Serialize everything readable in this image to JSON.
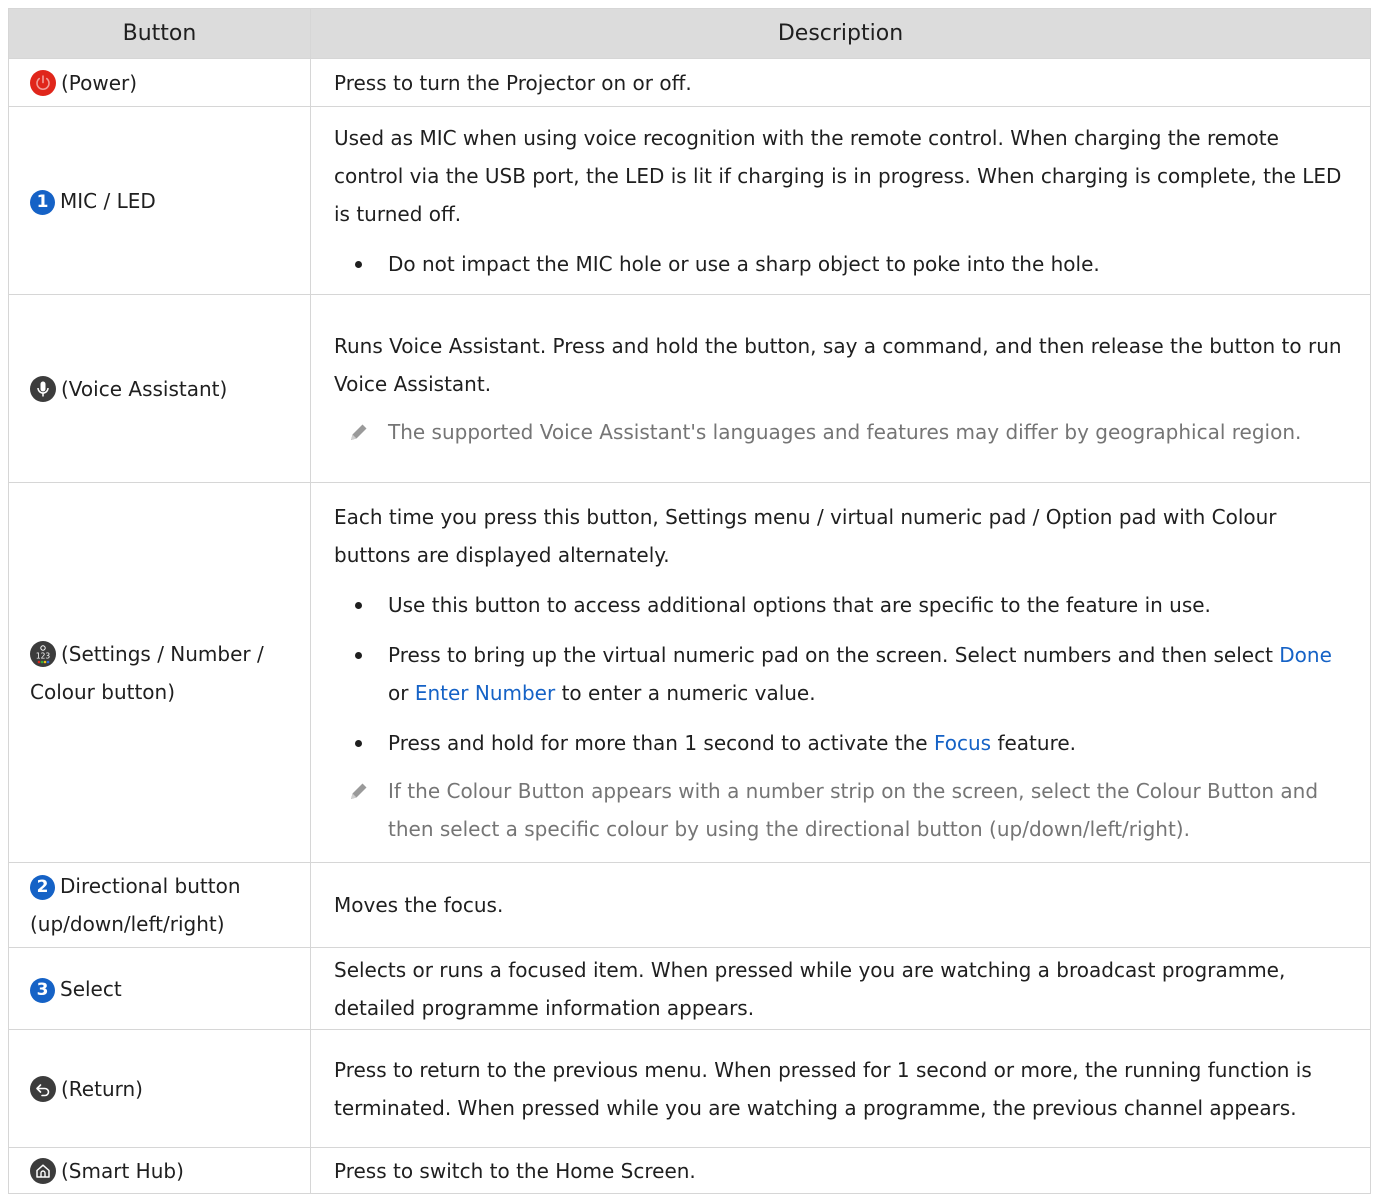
{
  "headers": {
    "button": "Button",
    "description": "Description"
  },
  "colors": {
    "header_bg": "#dcdcdc",
    "link": "#1562c6",
    "power": "#e0261b",
    "icon_dark": "#3c3c3c",
    "note_text": "#757575"
  },
  "rows": [
    {
      "icon": "power-icon",
      "label": "(Power)",
      "desc": "Press to turn the Projector on or off."
    },
    {
      "badge": "1",
      "label": "MIC / LED",
      "desc": "Used as MIC when using voice recognition with the remote control. When charging the remote control via the USB port, the LED is lit if charging is in progress. When charging is complete, the LED is turned off.",
      "bullet": "Do not impact the MIC hole or use a sharp object to poke into the hole."
    },
    {
      "icon": "microphone-icon",
      "label": "(Voice Assistant)",
      "desc": "Runs Voice Assistant. Press and hold the button, say a command, and then release the button to run Voice Assistant.",
      "note": "The supported Voice Assistant's languages and features may differ by geographical region."
    },
    {
      "icon": "settings-number-color-icon",
      "label": "(Settings / Number / Colour button)",
      "desc": "Each time you press this button, Settings menu / virtual numeric pad / Option pad with Colour buttons are displayed alternately.",
      "bullet1": "Use this button to access additional options that are specific to the feature in use.",
      "bullet2": {
        "before": "Press to bring up the virtual numeric pad on the screen. Select numbers and then select ",
        "link1": "Done",
        "mid": " or ",
        "link2": "Enter Number",
        "after": " to enter a numeric value."
      },
      "bullet3": {
        "before": "Press and hold for more than 1 second to activate the ",
        "link": "Focus",
        "after": " feature."
      },
      "note": "If the Colour Button appears with a number strip on the screen, select the Colour Button and then select a specific colour by using the directional button (up/down/left/right)."
    },
    {
      "badge": "2",
      "label": "Directional button (up/down/left/right)",
      "desc": "Moves the focus."
    },
    {
      "badge": "3",
      "label": "Select",
      "desc": "Selects or runs a focused item. When pressed while you are watching a broadcast programme, detailed programme information appears."
    },
    {
      "icon": "return-icon",
      "label": "(Return)",
      "desc": "Press to return to the previous menu. When pressed for 1 second or more, the running function is terminated. When pressed while you are watching a programme, the previous channel appears."
    },
    {
      "icon": "home-icon",
      "label": "(Smart Hub)",
      "desc": "Press to switch to the Home Screen."
    }
  ]
}
